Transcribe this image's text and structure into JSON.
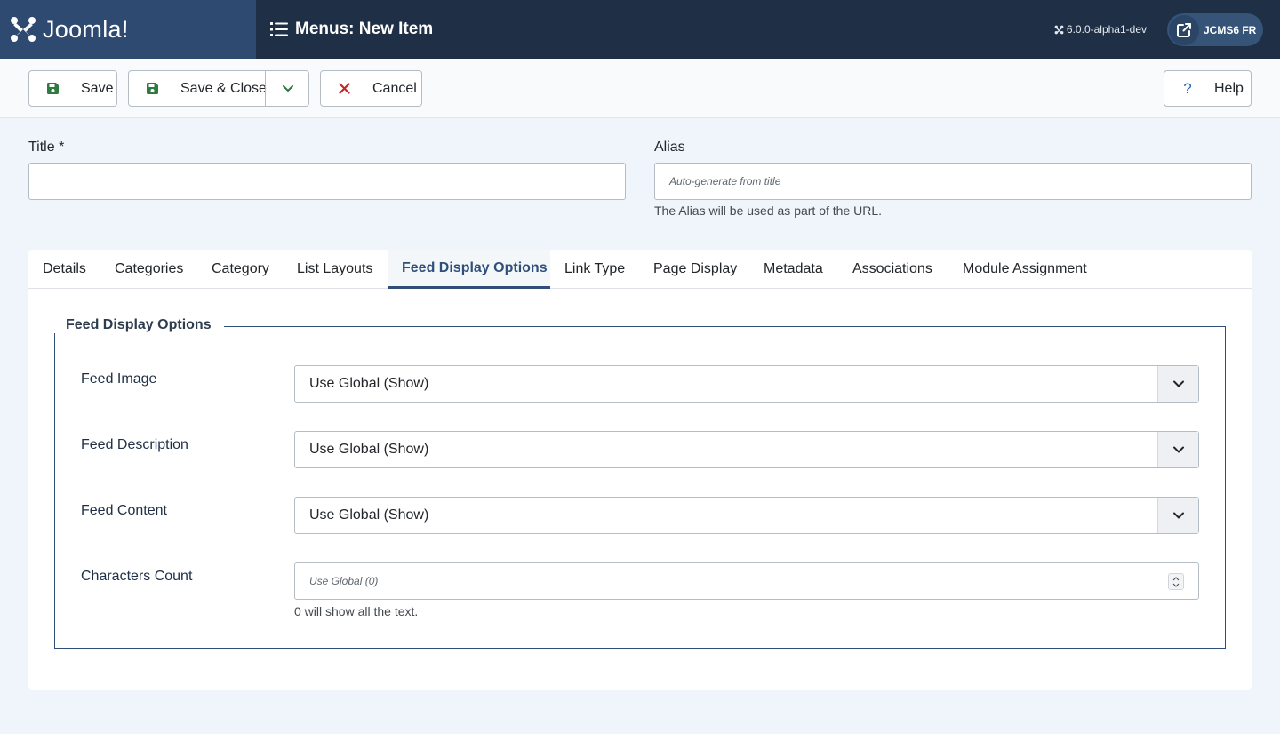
{
  "header": {
    "logo_text": "Joomla!",
    "page_title": "Menus: New Item",
    "version": "6.0.0-alpha1-dev",
    "site_button": "JCMS6 FR"
  },
  "toolbar": {
    "save": "Save",
    "save_close": "Save & Close",
    "cancel": "Cancel",
    "help": "Help"
  },
  "form": {
    "title_label": "Title *",
    "title_value": "",
    "alias_label": "Alias",
    "alias_placeholder": "Auto-generate from title",
    "alias_help": "The Alias will be used as part of the URL."
  },
  "tabs": [
    {
      "label": "Details"
    },
    {
      "label": "Categories"
    },
    {
      "label": "Category"
    },
    {
      "label": "List Layouts"
    },
    {
      "label": "Feed Display Options",
      "active": true
    },
    {
      "label": "Link Type"
    },
    {
      "label": "Page Display"
    },
    {
      "label": "Metadata"
    },
    {
      "label": "Associations"
    },
    {
      "label": "Module Assignment"
    }
  ],
  "feed_options": {
    "legend": "Feed Display Options",
    "feed_image_label": "Feed Image",
    "feed_image_value": "Use Global (Show)",
    "feed_description_label": "Feed Description",
    "feed_description_value": "Use Global (Show)",
    "feed_content_label": "Feed Content",
    "feed_content_value": "Use Global (Show)",
    "characters_count_label": "Characters Count",
    "characters_count_placeholder": "Use Global (0)",
    "characters_count_help": "0 will show all the text."
  },
  "colors": {
    "header_bg": "#1f2f46",
    "logo_bg": "#2f4a71",
    "accent": "#2f4f7a",
    "save_icon": "#2f7a3e",
    "cancel_icon": "#c52827",
    "help_icon": "#2a69b8"
  }
}
